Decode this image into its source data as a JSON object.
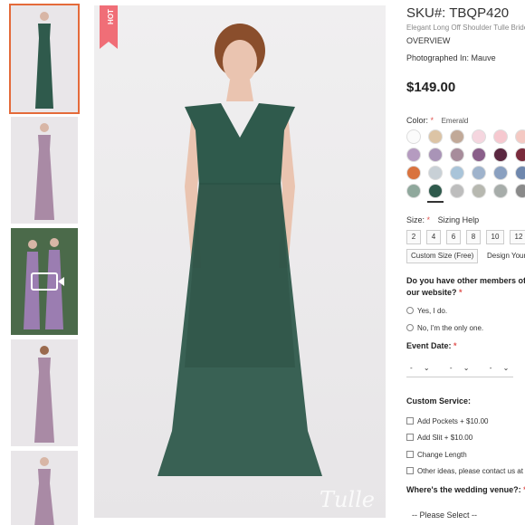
{
  "thumbnails": [
    {
      "kind": "image",
      "dress_color": "#2f5a4c",
      "active": true
    },
    {
      "kind": "image",
      "dress_color": "#a98aa5",
      "active": false
    },
    {
      "kind": "video",
      "dress_color": "#9b7db1",
      "active": false
    },
    {
      "kind": "image",
      "dress_color": "#a98aa5",
      "active": false
    },
    {
      "kind": "image",
      "dress_color": "#a98aa5",
      "active": false
    }
  ],
  "main_image": {
    "badge": "HOT",
    "watermark": "Tulle",
    "dress_color": "#2f5a4c"
  },
  "product": {
    "sku_label": "SKU#:",
    "sku": "TBQP420",
    "subtitle": "Elegant Long Off Shoulder Tulle Brides",
    "overview": "OVERVIEW",
    "photographed_in": "Photographed In: Mauve",
    "price": "$149.00"
  },
  "color": {
    "label": "Color:",
    "required_mark": "*",
    "selected": "Emerald",
    "swatches": [
      [
        "#fbfbfb",
        "#dcc4a5",
        "#c1a998",
        "#f5d6df",
        "#f6c8cf",
        "#f4c9c3"
      ],
      [
        "#b59bc0",
        "#a994b7",
        "#a78c9b",
        "#8a5f8a",
        "#5a2740",
        "#7a2b3c"
      ],
      [
        "#d9733e",
        "#c8d0d6",
        "#a9c4d9",
        "#9fb3cc",
        "#8aa0c0",
        "#6f87ad"
      ],
      [
        "#8fa89c",
        "#2f5a4c",
        "#bdbdbd",
        "#b7b8b0",
        "#a7adaa",
        "#8a8a8a"
      ]
    ],
    "selected_index": [
      3,
      1
    ]
  },
  "size": {
    "label": "Size:",
    "required_mark": "*",
    "help": "Sizing Help",
    "options": [
      "2",
      "4",
      "6",
      "8",
      "10",
      "12"
    ],
    "custom_label": "Custom Size (Free)",
    "design_label": "Design Your"
  },
  "bridal_party": {
    "question": "Do you have other members of our website?",
    "required_mark": "*",
    "options": [
      "Yes, I do.",
      "No, I'm the only one."
    ]
  },
  "event_date": {
    "label": "Event Date:",
    "required_mark": "*",
    "selects": [
      "-",
      "-",
      "-"
    ]
  },
  "custom_service": {
    "label": "Custom Service:",
    "options": [
      "Add Pockets + $10.00",
      "Add Slit + $10.00",
      "Change Length",
      "Other ideas, please contact us at"
    ]
  },
  "venue": {
    "label": "Where's the wedding venue?:",
    "required_mark": "*",
    "select_value": "-- Please Select --"
  }
}
